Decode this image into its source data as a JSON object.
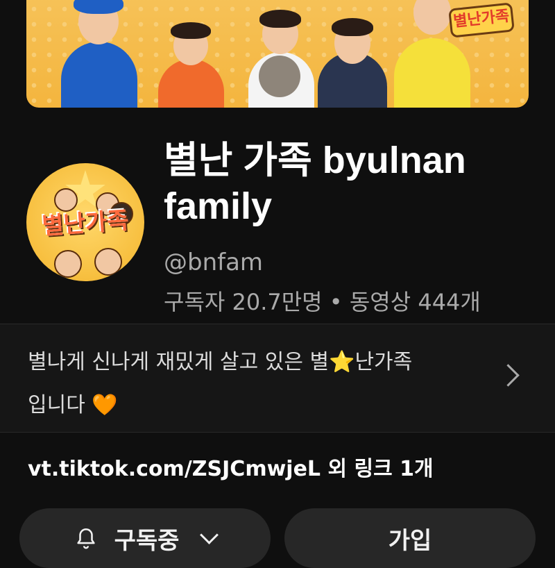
{
  "banner": {
    "logo_text": "별난가족"
  },
  "avatar": {
    "logo_text": "별난가족"
  },
  "channel": {
    "title": "별난 가족 byulnan family",
    "handle": "@bnfam",
    "stats": "구독자 20.7만명 • 동영상 444개"
  },
  "description": {
    "line1": "별나게 신나게 재밌게 살고 있은 별",
    "star": "⭐",
    "line1b": "난가족",
    "line2": "입니다",
    "heart": "🧡"
  },
  "links": {
    "primary": "vt.tiktok.com/ZSJCmwjeL",
    "more": " 외 링크 1개"
  },
  "buttons": {
    "subscribe_label": "구독중",
    "join_label": "가입"
  },
  "icons": {
    "bell": "bell-icon",
    "chevron_down": "chevron-down-icon",
    "chevron_right": "chevron-right-icon"
  },
  "colors": {
    "background": "#0f0f0f",
    "button_bg": "#272727",
    "secondary_text": "#aaaaaa"
  }
}
